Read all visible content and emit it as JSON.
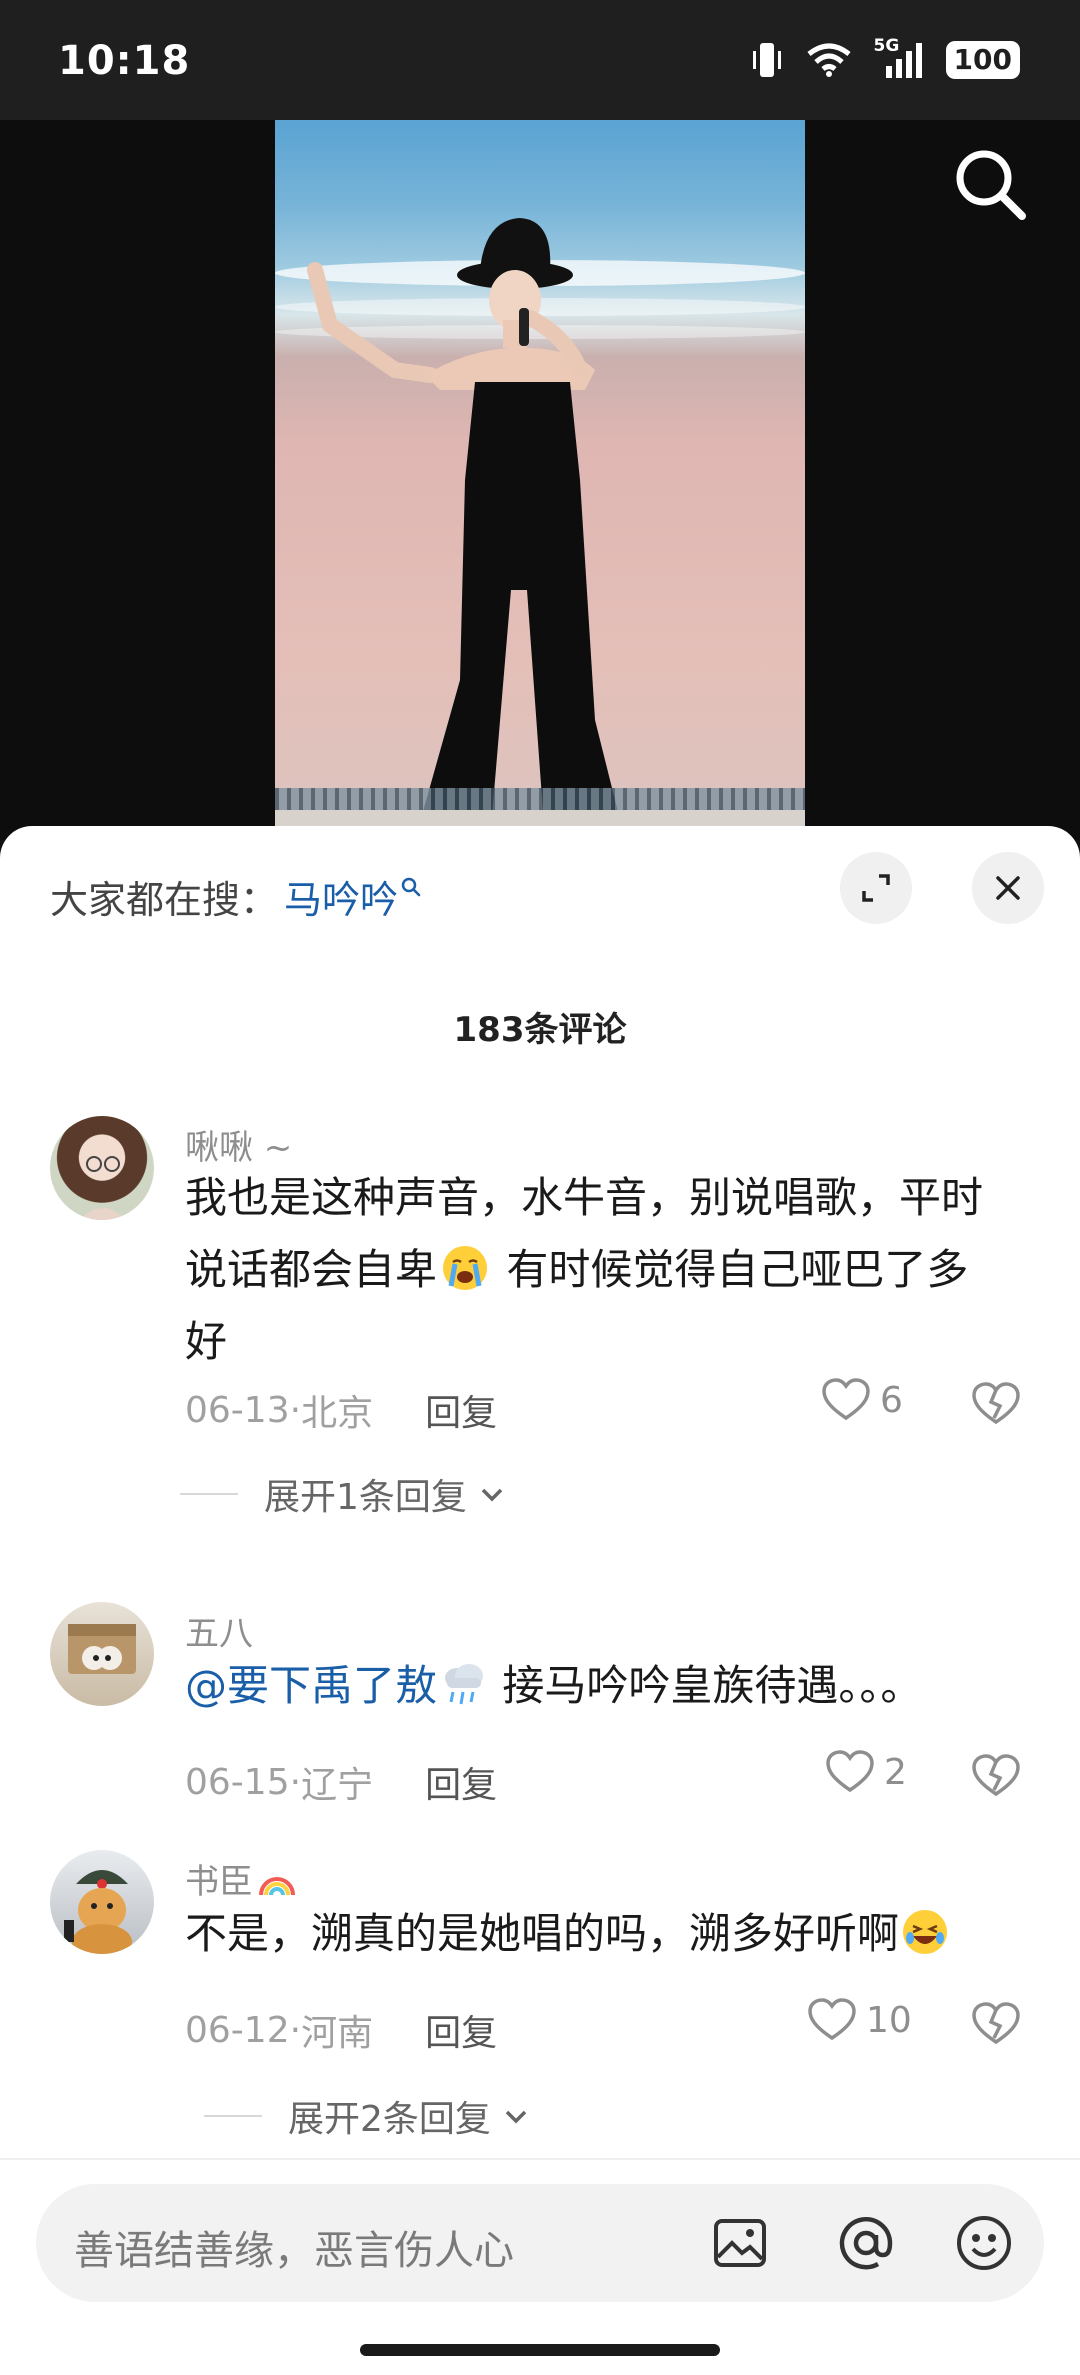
{
  "status_bar": {
    "time": "10:18",
    "network": "5G",
    "battery": "100"
  },
  "video": {
    "search_icon": "search-icon"
  },
  "sheet": {
    "trending_label": "大家都在搜：",
    "trending_term": "马吟吟",
    "comment_count": "183条评论",
    "expand_icon": "expand-icon",
    "close_icon": "close-icon"
  },
  "comments": [
    {
      "user": "啾啾 ~",
      "line1": "我也是这种声音，水牛音，别说唱歌，平时",
      "line2_a": "说话都会自卑",
      "line2_b": " 有时候觉得自己哑巴了多",
      "line3": "好",
      "date": "06-13",
      "location": "北京",
      "reply": "回复",
      "likes": "6",
      "expand": "展开1条回复"
    },
    {
      "user": "五八",
      "mention": "@要下禹了敖",
      "text": " 接马吟吟皇族待遇。。。",
      "date": "06-15",
      "location": "辽宁",
      "reply": "回复",
      "likes": "2"
    },
    {
      "user": "书臣",
      "text": "不是，溯真的是她唱的吗，溯多好听啊",
      "date": "06-12",
      "location": "河南",
      "reply": "回复",
      "likes": "10",
      "expand": "展开2条回复"
    }
  ],
  "meta_separator": " · ",
  "input": {
    "placeholder": "善语结善缘，恶言伤人心",
    "icons": [
      "image-icon",
      "at-icon",
      "emoji-icon"
    ]
  }
}
